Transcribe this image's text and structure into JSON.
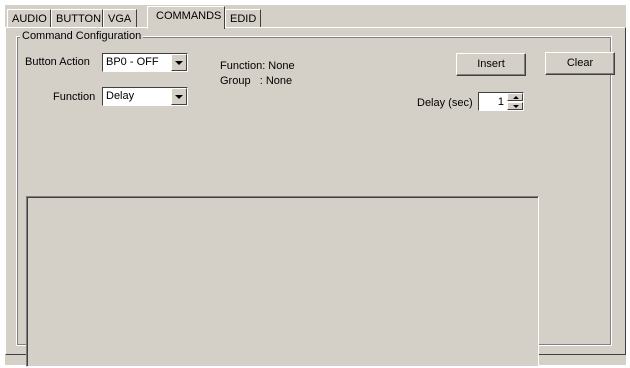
{
  "tabs": [
    {
      "label": "AUDIO",
      "active": false
    },
    {
      "label": "BUTTON",
      "active": false
    },
    {
      "label": "VGA",
      "active": false
    },
    {
      "label": "COMMANDS",
      "active": true
    },
    {
      "label": "EDID",
      "active": false
    }
  ],
  "group": {
    "legend": "Command Configuration"
  },
  "button_action": {
    "label": "Button Action",
    "value": "BP0 - OFF"
  },
  "function": {
    "label": "Function",
    "value": "Delay"
  },
  "info": {
    "function_line": "Function: None",
    "group_line": "Group   : None"
  },
  "buttons": {
    "insert": "Insert",
    "clear": "Clear"
  },
  "delay": {
    "label": "Delay (sec)",
    "value": "1"
  },
  "icons": [
    "chevron-down-icon",
    "spin-up-icon",
    "spin-down-icon"
  ]
}
